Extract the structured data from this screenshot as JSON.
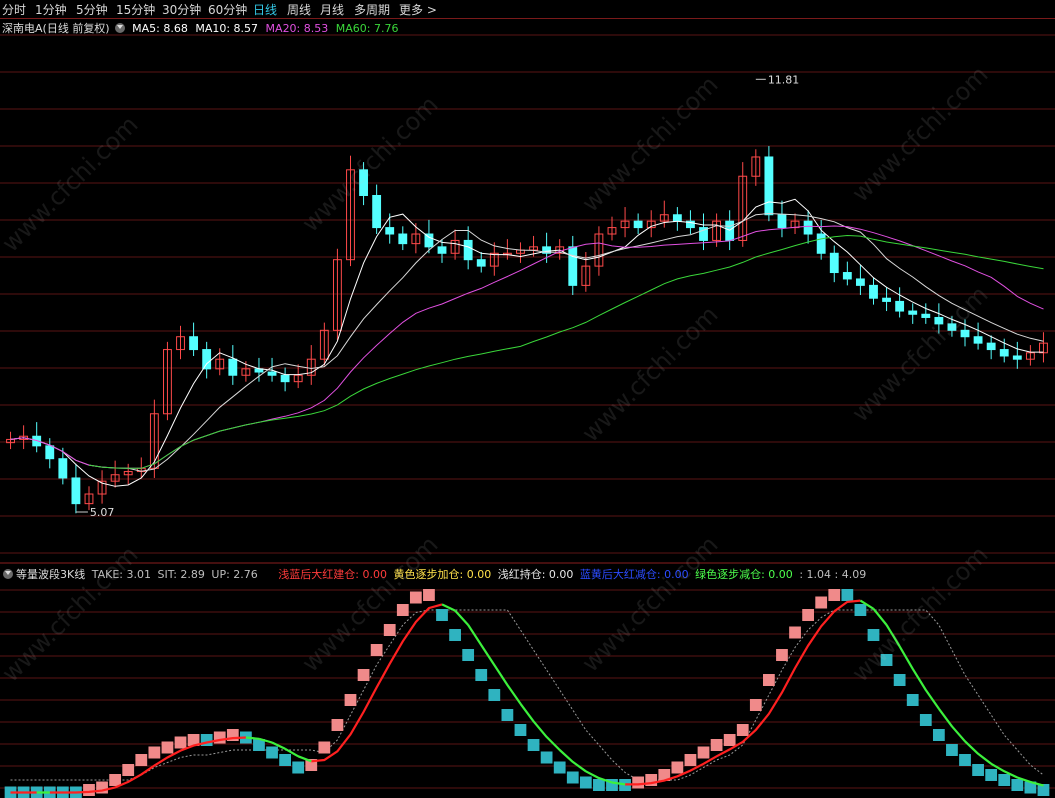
{
  "toolbar": {
    "tabs": [
      "分时",
      "1分钟",
      "5分钟",
      "15分钟",
      "30分钟",
      "60分钟",
      "日线",
      "周线",
      "月线",
      "多周期",
      "更多"
    ],
    "active_index": 6,
    "more_chevron": "chevron-right-icon"
  },
  "main_legend": {
    "title": "深南电A(日线 前复权)",
    "ma5": "MA5: 8.68",
    "ma10": "MA10: 8.57",
    "ma20": "MA20: 8.53",
    "ma60": "MA60: 7.76"
  },
  "annotations": {
    "high": "11.81",
    "low": "5.07"
  },
  "sub_legend": {
    "title": "等量波段3K线",
    "take": "TAKE: 3.01",
    "sit": "SIT: 2.89",
    "up": "UP: 2.76",
    "item1": "浅蓝后大红建仓: 0.00",
    "item2": "黄色逐步加仓: 0.00",
    "item3": "浅红持仓: 0.00",
    "item4": "蓝黄后大红减仓: 0.00",
    "item5": "绿色逐步减仓: 0.00",
    "tail": ": 1.04 : 4.09"
  },
  "watermark": "www.cfchi.com",
  "colors": {
    "up": "#ff4a4a",
    "down": "#54ffff",
    "ma5": "#ffffff",
    "ma20": "#e050e0",
    "ma60": "#3ad63a",
    "grid": "#5a1515",
    "pink": "#f08a8a",
    "teal": "#2fb3c0",
    "red_line": "#ff2020",
    "green_line": "#3cf03c"
  },
  "chart_data": {
    "type": "candlestick",
    "title": "深南电A(日线 前复权)",
    "x_count": 80,
    "ylim": [
      4.4,
      12.5
    ],
    "price_high": 11.81,
    "price_low": 5.07,
    "ma": {
      "MA5": 8.68,
      "MA10": 8.57,
      "MA20": 8.53,
      "MA60": 7.76
    },
    "closes": [
      6.2,
      6.25,
      6.1,
      5.9,
      5.6,
      5.2,
      5.35,
      5.55,
      5.65,
      5.7,
      5.75,
      6.6,
      7.6,
      7.8,
      7.6,
      7.3,
      7.45,
      7.2,
      7.3,
      7.25,
      7.2,
      7.1,
      7.2,
      7.45,
      7.9,
      9.0,
      10.4,
      10.0,
      9.5,
      9.4,
      9.25,
      9.4,
      9.2,
      9.1,
      9.3,
      9.0,
      8.9,
      9.1,
      9.1,
      9.15,
      9.2,
      9.1,
      9.2,
      8.6,
      8.9,
      9.4,
      9.5,
      9.6,
      9.5,
      9.6,
      9.7,
      9.6,
      9.5,
      9.3,
      9.6,
      9.3,
      10.3,
      10.6,
      9.7,
      9.5,
      9.6,
      9.4,
      9.1,
      8.8,
      8.7,
      8.6,
      8.4,
      8.35,
      8.2,
      8.15,
      8.1,
      8.0,
      7.9,
      7.8,
      7.7,
      7.6,
      7.5,
      7.45,
      7.55,
      7.7
    ],
    "indicator": {
      "name": "等量波段3K线",
      "TAKE": 3.01,
      "SIT": 2.89,
      "UP": 2.76,
      "ylim": [
        0,
        4.3
      ],
      "red_line_tail": 4.09,
      "levels": [
        0.05,
        0.05,
        0.05,
        0.05,
        0.05,
        0.05,
        0.1,
        0.15,
        0.3,
        0.5,
        0.7,
        0.85,
        0.95,
        1.05,
        1.1,
        1.1,
        1.15,
        1.2,
        1.15,
        1.0,
        0.85,
        0.7,
        0.55,
        0.6,
        0.95,
        1.4,
        1.9,
        2.4,
        2.9,
        3.3,
        3.7,
        3.95,
        4.0,
        3.6,
        3.2,
        2.8,
        2.4,
        2.0,
        1.6,
        1.3,
        1.0,
        0.75,
        0.55,
        0.35,
        0.25,
        0.2,
        0.2,
        0.2,
        0.25,
        0.3,
        0.4,
        0.55,
        0.7,
        0.85,
        1.0,
        1.1,
        1.3,
        1.8,
        2.3,
        2.8,
        3.25,
        3.6,
        3.85,
        4.0,
        4.0,
        3.7,
        3.2,
        2.7,
        2.3,
        1.9,
        1.5,
        1.2,
        0.9,
        0.7,
        0.5,
        0.4,
        0.3,
        0.2,
        0.15,
        0.1
      ]
    }
  }
}
